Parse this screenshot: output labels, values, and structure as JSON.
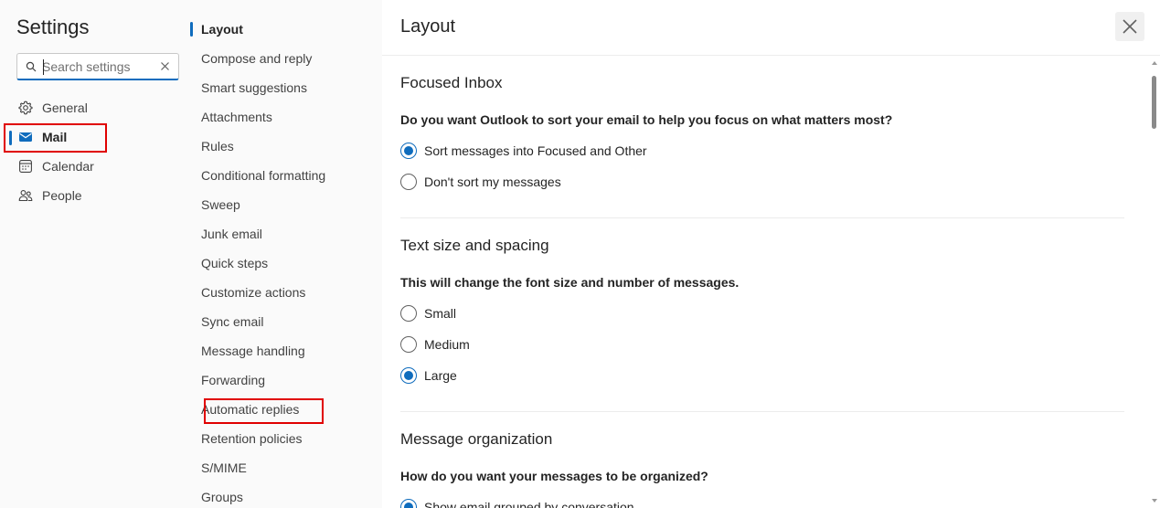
{
  "settings": {
    "title": "Settings",
    "search": {
      "placeholder": "Search settings",
      "value": ""
    },
    "nav": [
      {
        "label": "General",
        "icon": "gear-icon",
        "selected": false
      },
      {
        "label": "Mail",
        "icon": "mail-icon",
        "selected": true
      },
      {
        "label": "Calendar",
        "icon": "calendar-icon",
        "selected": false
      },
      {
        "label": "People",
        "icon": "people-icon",
        "selected": false
      }
    ]
  },
  "mail_menu": {
    "items": [
      "Layout",
      "Compose and reply",
      "Smart suggestions",
      "Attachments",
      "Rules",
      "Conditional formatting",
      "Sweep",
      "Junk email",
      "Quick steps",
      "Customize actions",
      "Sync email",
      "Message handling",
      "Forwarding",
      "Automatic replies",
      "Retention policies",
      "S/MIME",
      "Groups"
    ],
    "selected": "Layout",
    "highlighted": "Automatic replies"
  },
  "panel": {
    "title": "Layout",
    "close_icon": "close-icon",
    "sections": [
      {
        "title": "Focused Inbox",
        "question": "Do you want Outlook to sort your email to help you focus on what matters most?",
        "options": [
          {
            "label": "Sort messages into Focused and Other",
            "checked": true
          },
          {
            "label": "Don't sort my messages",
            "checked": false
          }
        ]
      },
      {
        "title": "Text size and spacing",
        "question": "This will change the font size and number of messages.",
        "options": [
          {
            "label": "Small",
            "checked": false
          },
          {
            "label": "Medium",
            "checked": false
          },
          {
            "label": "Large",
            "checked": true
          }
        ]
      },
      {
        "title": "Message organization",
        "question": "How do you want your messages to be organized?",
        "options": [
          {
            "label": "Show email grouped by conversation",
            "checked": true
          }
        ]
      }
    ]
  },
  "colors": {
    "accent": "#0f6cbd",
    "highlight": "#e00000"
  }
}
